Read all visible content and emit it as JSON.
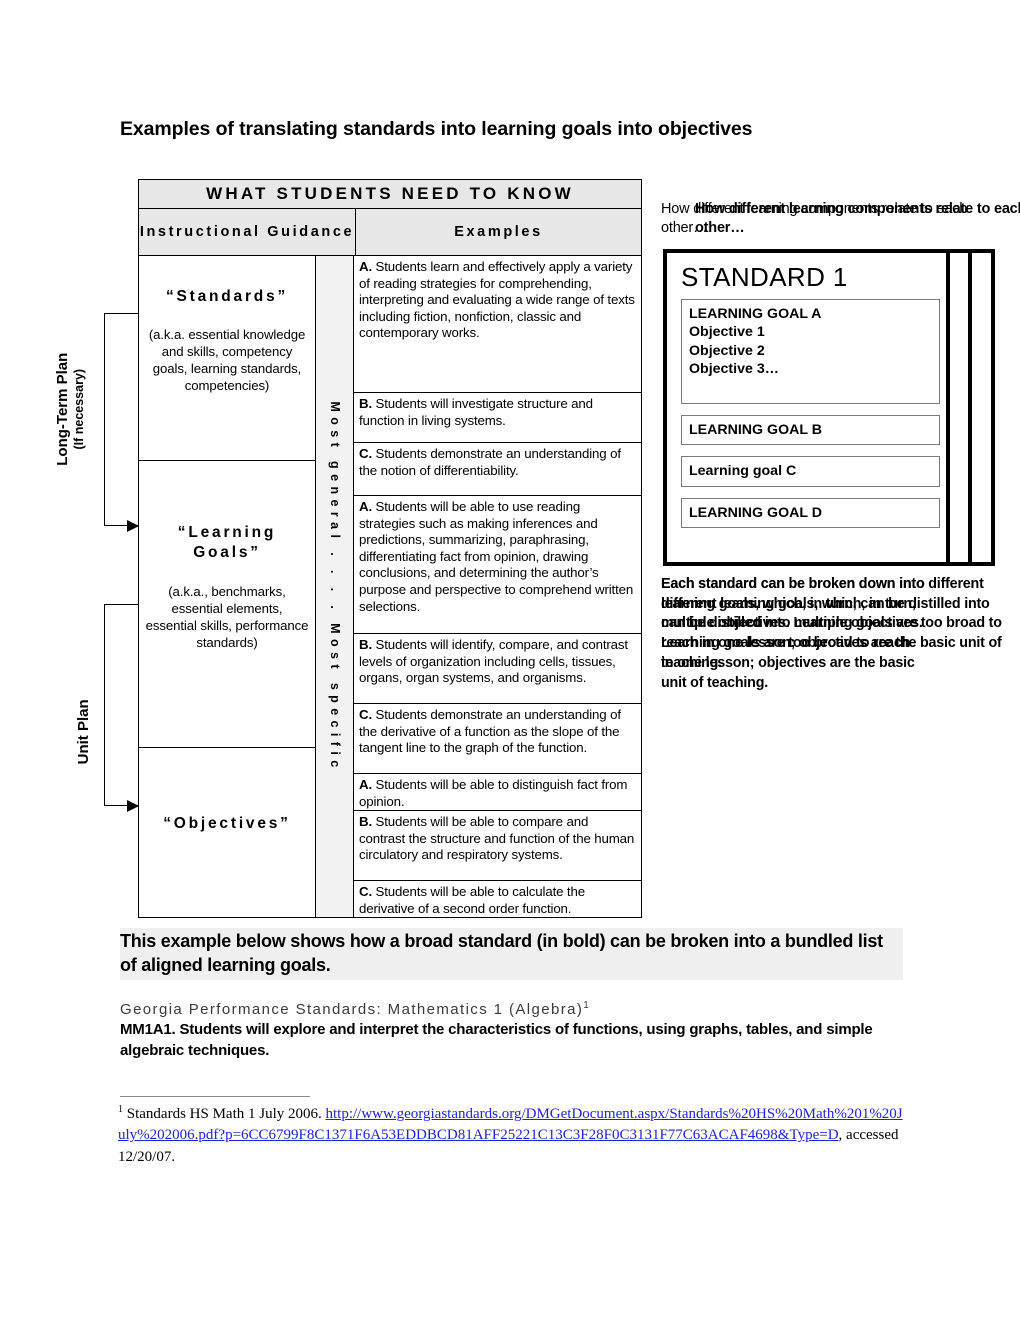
{
  "page": {
    "title": "Examples of translating standards into learning goals into objectives"
  },
  "matrix": {
    "banner": "WHAT STUDENTS NEED TO KNOW",
    "headers": {
      "left": "Instructional Guidance",
      "right": "Examples"
    },
    "scale": {
      "top_label": "Most general",
      "bottom_label": "Most specific",
      "combined": "Most general  .    .    .    .   Most specific"
    },
    "rows": [
      {
        "title": "“Standards”",
        "subtitle": "(a.k.a. essential knowledge and skills, competency goals, learning standards, competencies)",
        "examples": [
          {
            "letter": "A.",
            "text": "Students learn and effectively apply a variety of reading strategies for comprehending, interpreting and evaluating a wide range of texts including fiction, nonfiction, classic and contemporary works."
          },
          {
            "letter": "B.",
            "text": "Students will investigate structure and function in living systems."
          },
          {
            "letter": "C.",
            "text": "Students demonstrate an understanding of the notion of differentiability."
          }
        ]
      },
      {
        "title": "“Learning Goals”",
        "subtitle": "(a.k.a., benchmarks, essential elements, essential skills, performance standards)",
        "examples": [
          {
            "letter": "A.",
            "text": "Students will be able to use reading strategies such as making inferences and predictions, summarizing, paraphrasing, differentiating fact from opinion, drawing conclusions, and determining the author’s purpose and perspective to comprehend written selections."
          },
          {
            "letter": "B.",
            "text": "Students will identify, compare, and contrast levels of organization including cells, tissues, organs, organ systems, and organisms."
          },
          {
            "letter": "C.",
            "text": "Students demonstrate an understanding of the derivative of a function as the slope of the tangent line to the graph of the function."
          }
        ]
      },
      {
        "title": "“Objectives”",
        "subtitle": "",
        "examples": [
          {
            "letter": "A.",
            "text": "Students will be able to distinguish fact from opinion."
          },
          {
            "letter": "B.",
            "text": "Students will be able to compare and contrast the structure and function of the human circulatory and respiratory systems."
          },
          {
            "letter": "C.",
            "text": "Students will be able to calculate the derivative of a second order function."
          }
        ]
      }
    ]
  },
  "side_labels": {
    "long_term_main": "Long-Term Plan",
    "long_term_sub": "(If necessary)",
    "unit": "Unit Plan"
  },
  "right_panel": {
    "caption_plain": "How different learning components relate to each other…",
    "caption_bold": "How different learning components relate to each other…",
    "standard_title": "STANDARD 1",
    "goal_a_label": "LEARNING GOAL A",
    "goal_a_objectives": [
      "Objective 1",
      "Objective 2",
      "Objective 3…"
    ],
    "goal_b_label": "LEARNING GOAL B",
    "goal_c_label": "Learning goal C",
    "goal_d_label": "LEARNING GOAL D",
    "note_plain": "Each standard can be broken down into different learning goals, which, in turn, can be distilled into multiple objectives. Learning goals are too broad to reach in one lesson; objectives are the basic unit of teaching.",
    "note_bold": "Each standard can be broken down into different learning goals, which, in turn, can be distilled into multiple objectives. Learning goals are too broad to reach in one lesson; objectives are the basic unit of teaching."
  },
  "bottom": {
    "callout": "This example below shows how a broad standard (in bold) can be broken into a bundled list of aligned learning goals.",
    "gps_label": "Georgia Performance Standards: Mathematics 1 (Algebra)",
    "gps_sup": "1",
    "standard_text": "MM1A1. Students will explore and interpret the characteristics of functions, using graphs, tables, and simple algebraic techniques."
  },
  "footnote": {
    "marker": "1",
    "prefix": " Standards HS Math 1 July 2006. ",
    "url": "http://www.georgiastandards.org/DMGetDocument.aspx/Standards%20HS%20Math%201%20July%202006.pdf?p=6CC6799F8C1371F6A53EDDBCD81AFF25221C13C3F28F0C3131F77C63ACAF4698&Type=D",
    "suffix": ",  accessed 12/20/07.",
    "link_color": "#2222dd"
  }
}
